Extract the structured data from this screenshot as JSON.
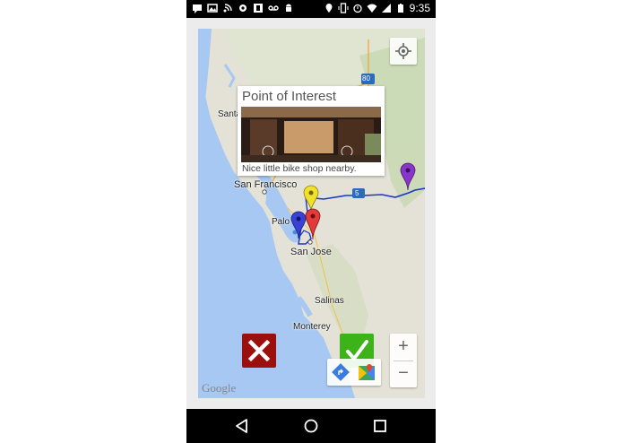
{
  "status_bar": {
    "time": "9:35"
  },
  "map": {
    "labels": {
      "santa_rosa": "Santa",
      "san_francisco": "San Francisco",
      "palo_alto": "Palo",
      "san_jose": "San Jose",
      "salinas": "Salinas",
      "monterey": "Monterey",
      "i80": "80",
      "i5": "5"
    },
    "google_logo": "Google",
    "markers": [
      "yellow-marker",
      "purple-marker",
      "blue-marker",
      "red-marker"
    ]
  },
  "popup": {
    "title": "Point of Interest",
    "description": "Nice little bike shop nearby."
  },
  "controls": {
    "zoom_in": "+",
    "zoom_out": "−"
  },
  "colors": {
    "cancel": "#9c0f0f",
    "confirm": "#3cb318",
    "route": "#1a37c8"
  }
}
